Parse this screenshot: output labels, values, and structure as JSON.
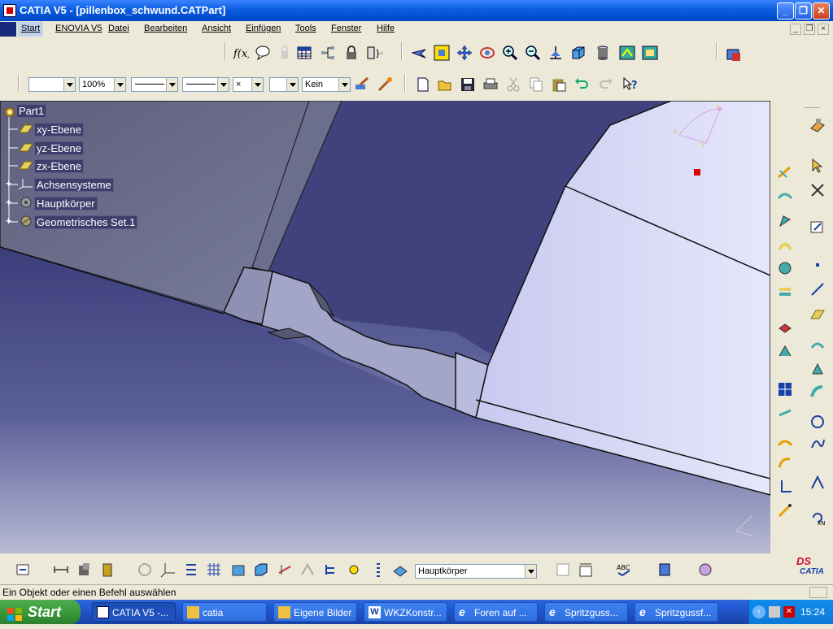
{
  "window": {
    "title": "CATIA V5 - [pillenbox_schwund.CATPart]"
  },
  "menu": {
    "items": [
      "Start",
      "ENOVIA V5",
      "Datei",
      "Bearbeiten",
      "Ansicht",
      "Einfügen",
      "Tools",
      "Fenster",
      "Hilfe"
    ]
  },
  "graphic_props": {
    "zoom": "100%",
    "layer": "Kein",
    "cross": "×"
  },
  "tree": {
    "root": "Part1",
    "nodes": [
      "xy-Ebene",
      "yz-Ebene",
      "zx-Ebene",
      "Achsensysteme",
      "Hauptkörper",
      "Geometrisches Set.1"
    ]
  },
  "compass": {
    "x": "x",
    "y": "y",
    "z": "z"
  },
  "bottom_toolbar": {
    "body_select": "Hauptkörper",
    "abc": "ABC"
  },
  "status": {
    "text": "Ein Objekt oder einen Befehl auswählen"
  },
  "branding": {
    "logo_text": "CATIA",
    "logo_mark": "DS",
    "accent": "#c8102e"
  },
  "taskbar": {
    "start_label": "Start",
    "tasks": [
      "CATIA V5 -...",
      "catia",
      "Eigene Bilder",
      "WKZKonstr...",
      "Foren auf ...",
      "Spritzguss...",
      "Spritzgussf..."
    ],
    "clock": "15:24"
  }
}
